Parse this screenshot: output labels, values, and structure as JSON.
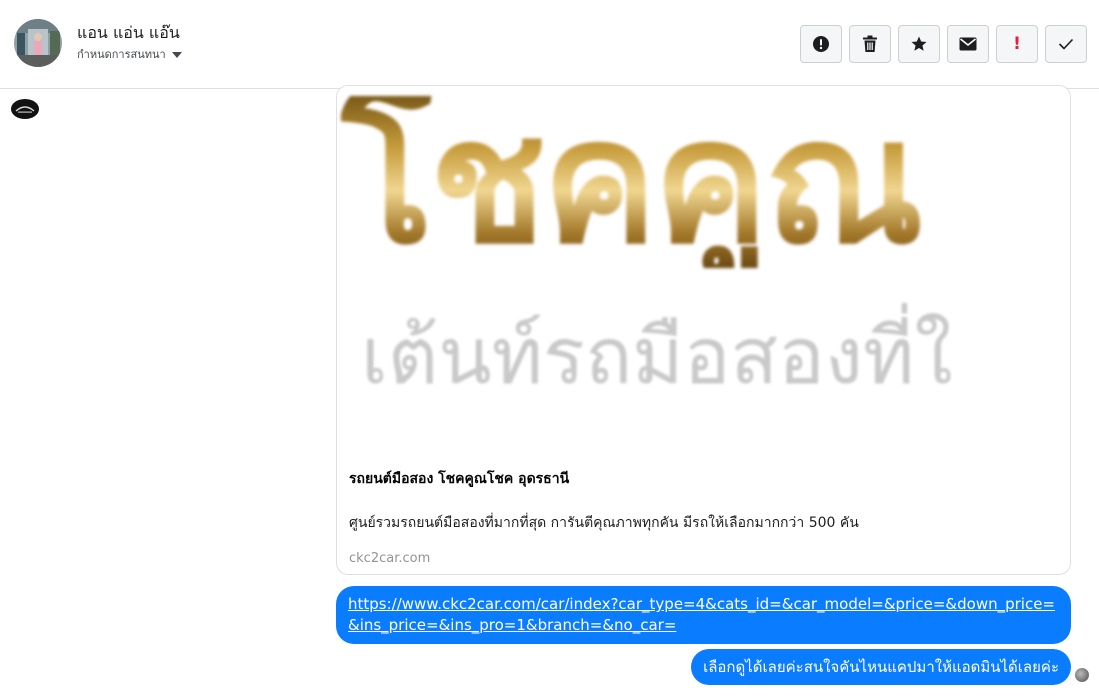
{
  "header": {
    "contact_name": "แอน แอ่น แอ๊น",
    "conversation_settings": "กำหนดการสนทนา",
    "actions": [
      {
        "name": "report-button",
        "icon": "alert-circle-icon"
      },
      {
        "name": "delete-button",
        "icon": "trash-icon"
      },
      {
        "name": "star-button",
        "icon": "star-icon"
      },
      {
        "name": "mark-unread-button",
        "icon": "envelope-icon"
      },
      {
        "name": "important-button",
        "icon": "exclamation-icon",
        "label": "!"
      },
      {
        "name": "done-button",
        "icon": "check-icon"
      }
    ]
  },
  "link_card": {
    "title": "รถยนต์มือสอง โชคคูณโชค อุดรธานี",
    "description": "ศูนย์รวมรถยนต์มือสองที่มากที่สุด การันตีคุณภาพทุกคัน มีรถให้เลือกมากกว่า 500 คัน",
    "domain": "ckc2car.com",
    "image_brand": "โชคคูณ",
    "image_tagline": "เต้นท์รถมือสองที่ใ"
  },
  "messages": [
    {
      "type": "link",
      "text": "https://www.ckc2car.com/car/index?car_type=4&cats_id=&car_model=&price=&down_price=&ins_price=&ins_pro=1&branch=&no_car="
    },
    {
      "type": "text",
      "text": "เลือกดูได้เลยค่ะสนใจคันไหนแคปมาให้แอดมินได้เลยค่ะ"
    }
  ],
  "colors": {
    "bubble": "#0a7cff",
    "important": "#e41e3f",
    "border": "#dddfe2"
  }
}
